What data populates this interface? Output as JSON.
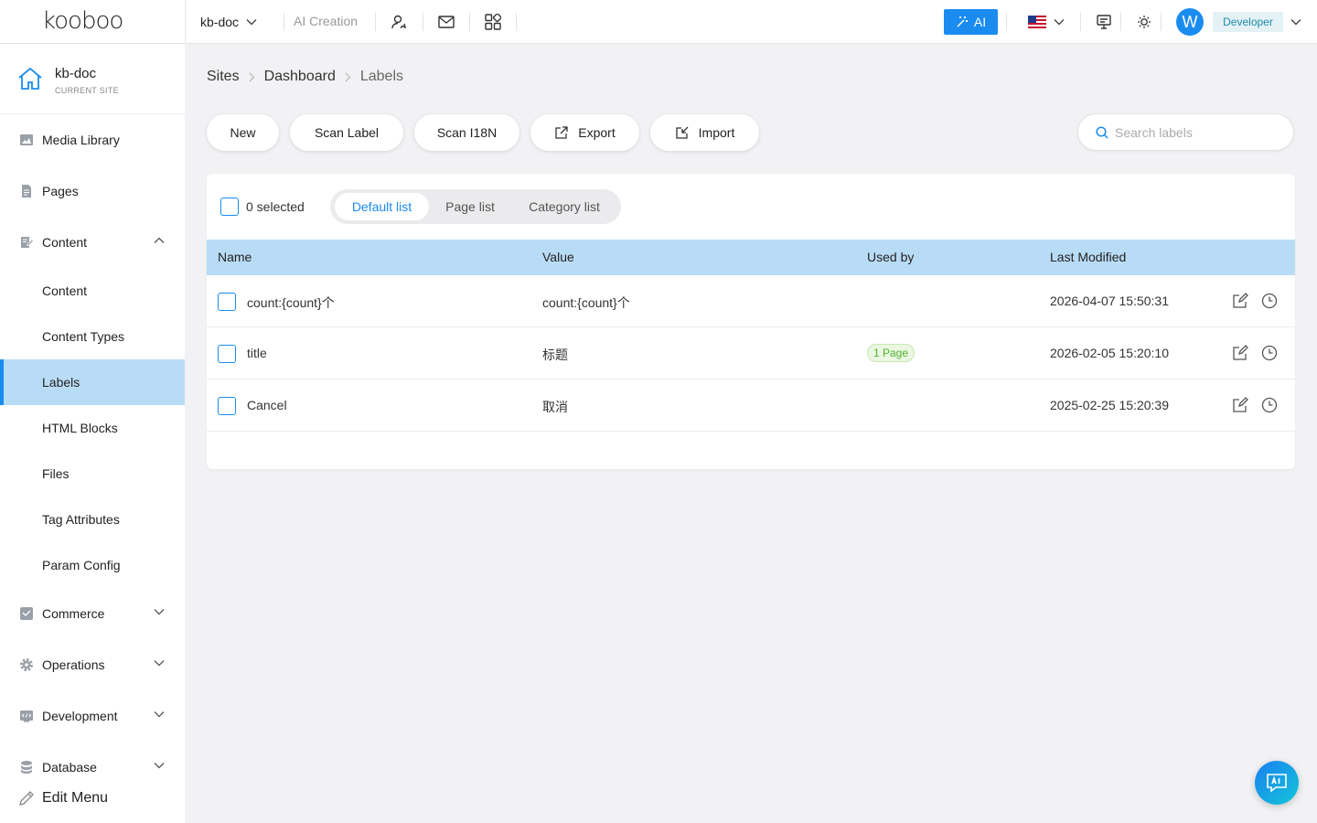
{
  "header": {
    "logo": "kooboo",
    "site_name": "kb-doc",
    "ai_creation": "AI Creation",
    "ai_button": "AI",
    "avatar_letter": "W",
    "role": "Developer",
    "accent_color": "#1a8cf0"
  },
  "sidebar": {
    "current_site_name": "kb-doc",
    "current_site_caption": "CURRENT SITE",
    "items": [
      {
        "label": "Media Library",
        "icon": "image-icon"
      },
      {
        "label": "Pages",
        "icon": "page-icon"
      },
      {
        "label": "Content",
        "icon": "content-icon",
        "expanded": true
      },
      {
        "label": "Content"
      },
      {
        "label": "Content Types"
      },
      {
        "label": "Labels",
        "active": true
      },
      {
        "label": "HTML Blocks"
      },
      {
        "label": "Files"
      },
      {
        "label": "Tag Attributes"
      },
      {
        "label": "Param Config"
      },
      {
        "label": "Commerce",
        "icon": "cart-icon"
      },
      {
        "label": "Operations",
        "icon": "gear-icon"
      },
      {
        "label": "Development",
        "icon": "code-icon"
      },
      {
        "label": "Database",
        "icon": "database-icon"
      }
    ],
    "edit_menu": "Edit Menu"
  },
  "breadcrumb": [
    "Sites",
    "Dashboard",
    "Labels"
  ],
  "toolbar": {
    "new": "New",
    "scan_label": "Scan Label",
    "scan_i18n": "Scan I18N",
    "export": "Export",
    "import": "Import",
    "search_placeholder": "Search labels"
  },
  "list": {
    "selected_text": "0 selected",
    "tabs": [
      "Default list",
      "Page list",
      "Category list"
    ],
    "active_tab": "Default list",
    "columns": [
      "Name",
      "Value",
      "Used by",
      "Last Modified"
    ],
    "rows": [
      {
        "name": "count:{count}个",
        "value": "count:{count}个",
        "used_by": "",
        "modified": "2026-04-07 15:50:31"
      },
      {
        "name": "title",
        "value": "标题",
        "used_by": "1 Page",
        "modified": "2026-02-05 15:20:10"
      },
      {
        "name": "Cancel",
        "value": "取消",
        "used_by": "",
        "modified": "2025-02-25 15:20:39"
      }
    ]
  }
}
